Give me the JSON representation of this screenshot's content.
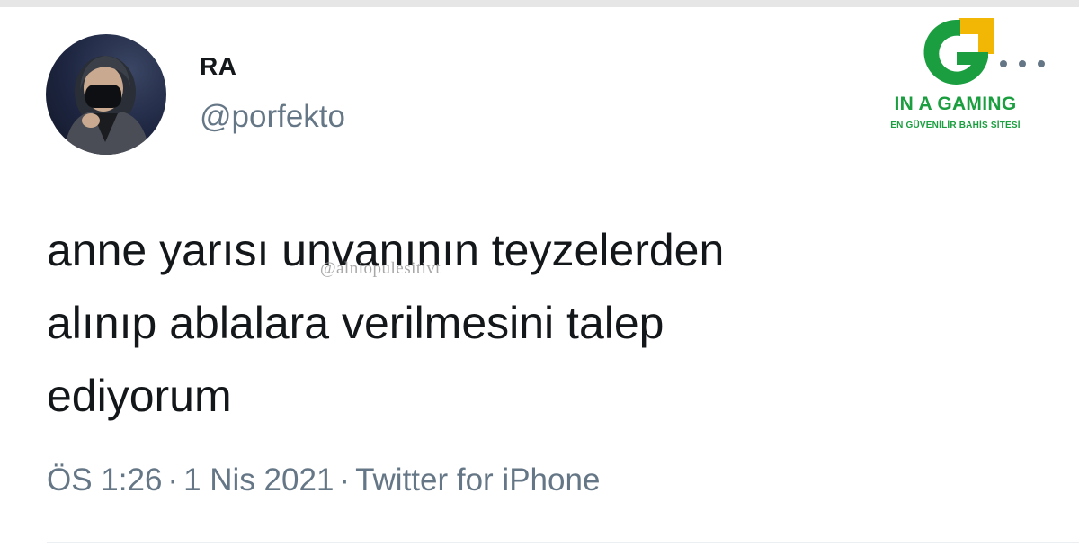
{
  "tweet": {
    "display_name": "RA",
    "handle": "@porfekto",
    "text_lines": [
      "anne yarısı unvanının teyzelerden",
      "alınıp ablalara verilmesini talep",
      "ediyorum"
    ],
    "time": "ÖS 1:26",
    "date": "1 Nis 2021",
    "source": "Twitter for iPhone",
    "separator": "·",
    "more_icon": "more-horizontal-icon"
  },
  "watermark": {
    "text": "@alniopulesitivt"
  },
  "overlay_logo": {
    "title": "IN A GAMING",
    "subtitle": "EN GÜVENİLİR BAHİS SİTESİ",
    "colors": {
      "green": "#1a9e3f",
      "yellow": "#f2b705"
    }
  }
}
